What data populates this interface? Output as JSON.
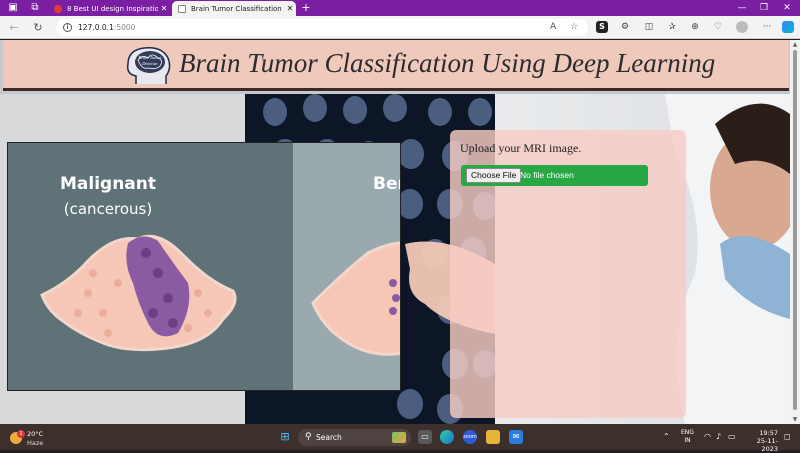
{
  "browser": {
    "tabs": [
      {
        "label": "8 Best UI design Inspiration Sites"
      },
      {
        "label": "Brain Tumor Classification Using"
      }
    ],
    "new_tab_glyph": "+",
    "address": {
      "host": "127.0.0.1",
      "port": ":5000"
    },
    "read_aloud_label": "A",
    "window_controls": {
      "minimize": "—",
      "maximize": "❐",
      "close": "✕"
    }
  },
  "header": {
    "logo_text_line1": "Brain Tumor",
    "logo_text_line2": "Detector",
    "title": "Brain Tumor Classification Using Deep Learning"
  },
  "carousel": {
    "left_title": "Malignant",
    "left_subtitle": "(cancerous)",
    "right_title_partial": "Ber"
  },
  "upload": {
    "prompt": "Upload your MRI image.",
    "choose_button": "Choose File",
    "file_status": "No file chosen"
  },
  "taskbar": {
    "weather_temp": "20°C",
    "weather_condition": "Haze",
    "weather_badge": "1",
    "search_label": "Search",
    "lang_line1": "ENG",
    "lang_line2": "IN",
    "time": "19:57",
    "date": "25-11-2023"
  },
  "colors": {
    "header_bg": "#f0c9bd",
    "upload_card_bg": "#f6ccc4",
    "file_input_bg": "#28a745",
    "tab_strip": "#7a1fa2",
    "malignant_panel": "#5f7277",
    "benign_panel": "#9aa9ad"
  },
  "icons": [
    "workspaces-icon",
    "tab-actions-icon",
    "refresh-icon",
    "back-icon",
    "info-icon",
    "read-aloud-icon",
    "favorite-star-icon",
    "sumo-extension-icon",
    "extensions-icon",
    "split-screen-icon",
    "favorites-icon",
    "collections-icon",
    "performance-icon",
    "profile-icon",
    "more-menu-icon",
    "copilot-icon",
    "windows-start-icon",
    "search-icon",
    "file-explorer-icon",
    "edge-icon",
    "zoom-icon",
    "mail-icon",
    "wifi-icon",
    "speaker-icon",
    "battery-icon"
  ]
}
